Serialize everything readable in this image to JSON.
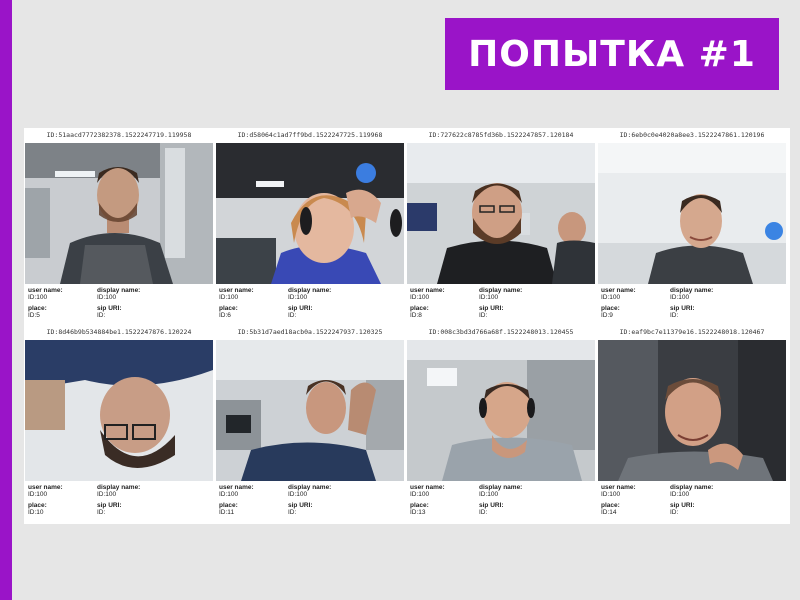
{
  "banner": {
    "title": "ПОПЫТКА #1"
  },
  "colors": {
    "accent": "#9a14c8",
    "panel": "#ffffff",
    "background": "#e6e6e6"
  },
  "labels": {
    "user_name": "user name:",
    "display_name": "display name:",
    "place": "place:",
    "sip_uri": "sip URI:"
  },
  "participants": [
    {
      "stream_id": "ID:51aacd7772382378.1522247719.119958",
      "user_id": "ID:100",
      "display_id": "ID:100",
      "place_id": "ID:5",
      "sip_id": "ID:"
    },
    {
      "stream_id": "ID:d58064c1ad7ff9bd.1522247725.119968",
      "user_id": "ID:100",
      "display_id": "ID:100",
      "place_id": "ID:6",
      "sip_id": "ID:"
    },
    {
      "stream_id": "ID:727622c8785fd36b.1522247857.120184",
      "user_id": "ID:100",
      "display_id": "ID:100",
      "place_id": "ID:8",
      "sip_id": "ID:"
    },
    {
      "stream_id": "ID:6eb0c0e4020a8ee3.1522247861.120196",
      "user_id": "ID:100",
      "display_id": "ID:100",
      "place_id": "ID:9",
      "sip_id": "ID:"
    },
    {
      "stream_id": "ID:8d46b9b534884be1.1522247876.120224",
      "user_id": "ID:100",
      "display_id": "ID:100",
      "place_id": "ID:10",
      "sip_id": "ID:"
    },
    {
      "stream_id": "ID:5b31d7aed18acb0a.1522247937.120325",
      "user_id": "ID:100",
      "display_id": "ID:100",
      "place_id": "ID:11",
      "sip_id": "ID:"
    },
    {
      "stream_id": "ID:008c3bd3d766a68f.1522248013.120455",
      "user_id": "ID:100",
      "display_id": "ID:100",
      "place_id": "ID:13",
      "sip_id": "ID:"
    },
    {
      "stream_id": "ID:eaf9bc7e11379e16.1522248018.120467",
      "user_id": "ID:100",
      "display_id": "ID:100",
      "place_id": "ID:14",
      "sip_id": "ID:"
    }
  ]
}
